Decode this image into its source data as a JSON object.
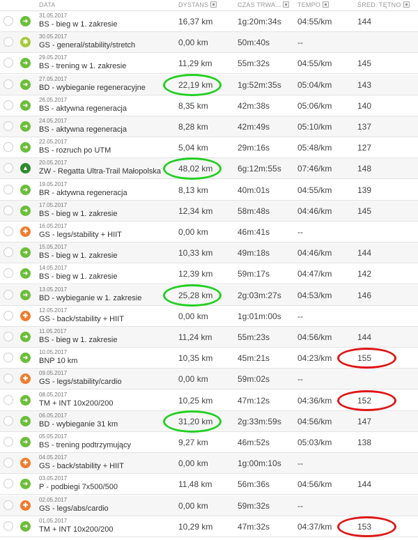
{
  "colors": {
    "sport_green": "#6cbe3a",
    "sport_orange": "#f07c2e",
    "sport_dark_green": "#2e8b2e",
    "sport_yellow_green": "#a6c93a",
    "highlight_green": "#22d022",
    "highlight_red": "#e01515"
  },
  "headers": {
    "date": "DATA",
    "distance": "DYSTANS",
    "duration": "CZAS TRWA...",
    "pace": "TEMPO",
    "heart_rate": "ŚRED. TĘTNO"
  },
  "rows": [
    {
      "date": "31.05.2017",
      "name": "BS - bieg w 1. zakresie",
      "distance": "16,37 km",
      "duration": "1g:20m:34s",
      "pace": "04:55/km",
      "hr": "144",
      "icon": "running-icon",
      "color": "#6cbe3a",
      "glyph": "➜",
      "hl_dist": false,
      "hl_hr": false
    },
    {
      "date": "30.05.2017",
      "name": "GS - general/stability/stretch",
      "distance": "0,00 km",
      "duration": "50m:40s",
      "pace": "--",
      "hr": "",
      "icon": "stretching-icon",
      "color": "#a6c93a",
      "glyph": "✱",
      "hl_dist": false,
      "hl_hr": false
    },
    {
      "date": "29.05.2017",
      "name": "BS - trening w 1. zakresie",
      "distance": "11,29 km",
      "duration": "55m:32s",
      "pace": "04:55/km",
      "hr": "145",
      "icon": "running-icon",
      "color": "#6cbe3a",
      "glyph": "➜",
      "hl_dist": false,
      "hl_hr": false
    },
    {
      "date": "27.05.2017",
      "name": "BD - wybieganie regeneracyjne",
      "distance": "22,19 km",
      "duration": "1g:52m:35s",
      "pace": "05:04/km",
      "hr": "143",
      "icon": "running-icon",
      "color": "#6cbe3a",
      "glyph": "➜",
      "hl_dist": true,
      "hl_hr": false
    },
    {
      "date": "26.05.2017",
      "name": "BS - aktywna regeneracja",
      "distance": "8,35 km",
      "duration": "42m:38s",
      "pace": "05:06/km",
      "hr": "140",
      "icon": "running-icon",
      "color": "#6cbe3a",
      "glyph": "➜",
      "hl_dist": false,
      "hl_hr": false
    },
    {
      "date": "24.05.2017",
      "name": "BS - aktywna regeneracja",
      "distance": "8,28 km",
      "duration": "42m:49s",
      "pace": "05:10/km",
      "hr": "137",
      "icon": "running-icon",
      "color": "#6cbe3a",
      "glyph": "➜",
      "hl_dist": false,
      "hl_hr": false
    },
    {
      "date": "22.05.2017",
      "name": "BS - rozruch po UTM",
      "distance": "5,04 km",
      "duration": "29m:16s",
      "pace": "05:48/km",
      "hr": "127",
      "icon": "running-icon",
      "color": "#6cbe3a",
      "glyph": "➜",
      "hl_dist": false,
      "hl_hr": false
    },
    {
      "date": "20.05.2017",
      "name": "ZW - Regatta Ultra-Trail Małopolska",
      "distance": "48,02 km",
      "duration": "6g:12m:55s",
      "pace": "07:46/km",
      "hr": "148",
      "icon": "trail-running-icon",
      "color": "#2e8b2e",
      "glyph": "▲",
      "hl_dist": true,
      "hl_hr": false
    },
    {
      "date": "19.05.2017",
      "name": "BR - aktywna regeneracja",
      "distance": "8,13 km",
      "duration": "40m:01s",
      "pace": "04:55/km",
      "hr": "139",
      "icon": "running-icon",
      "color": "#6cbe3a",
      "glyph": "➜",
      "hl_dist": false,
      "hl_hr": false
    },
    {
      "date": "17.05.2017",
      "name": "BS - bieg w 1. zakresie",
      "distance": "12,34 km",
      "duration": "58m:48s",
      "pace": "04:46/km",
      "hr": "145",
      "icon": "running-icon",
      "color": "#6cbe3a",
      "glyph": "➜",
      "hl_dist": false,
      "hl_hr": false
    },
    {
      "date": "16.05.2017",
      "name": "GS - legs/stability + HIIT",
      "distance": "0,00 km",
      "duration": "46m:41s",
      "pace": "--",
      "hr": "",
      "icon": "strength-icon",
      "color": "#f07c2e",
      "glyph": "✚",
      "hl_dist": false,
      "hl_hr": false
    },
    {
      "date": "15.05.2017",
      "name": "BS - bieg w 1. zakresie",
      "distance": "10,33 km",
      "duration": "49m:18s",
      "pace": "04:46/km",
      "hr": "144",
      "icon": "running-icon",
      "color": "#6cbe3a",
      "glyph": "➜",
      "hl_dist": false,
      "hl_hr": false
    },
    {
      "date": "14.05.2017",
      "name": "BS - bieg w 1. zakresie",
      "distance": "12,39 km",
      "duration": "59m:17s",
      "pace": "04:47/km",
      "hr": "142",
      "icon": "running-icon",
      "color": "#6cbe3a",
      "glyph": "➜",
      "hl_dist": false,
      "hl_hr": false
    },
    {
      "date": "13.05.2017",
      "name": "BD - wybieganie w 1. zakresie",
      "distance": "25,28 km",
      "duration": "2g:03m:27s",
      "pace": "04:53/km",
      "hr": "146",
      "icon": "running-icon",
      "color": "#6cbe3a",
      "glyph": "➜",
      "hl_dist": true,
      "hl_hr": false
    },
    {
      "date": "12.05.2017",
      "name": "GS - back/stability + HIIT",
      "distance": "0,00 km",
      "duration": "1g:01m:00s",
      "pace": "--",
      "hr": "",
      "icon": "strength-icon",
      "color": "#f07c2e",
      "glyph": "✚",
      "hl_dist": false,
      "hl_hr": false
    },
    {
      "date": "11.05.2017",
      "name": "BS - bieg w 1. zakresie",
      "distance": "11,24 km",
      "duration": "55m:23s",
      "pace": "04:56/km",
      "hr": "144",
      "icon": "running-icon",
      "color": "#6cbe3a",
      "glyph": "➜",
      "hl_dist": false,
      "hl_hr": false
    },
    {
      "date": "10.05.2017",
      "name": "BNP 10 km",
      "distance": "10,35 km",
      "duration": "45m:21s",
      "pace": "04:23/km",
      "hr": "155",
      "icon": "running-icon",
      "color": "#6cbe3a",
      "glyph": "➜",
      "hl_dist": false,
      "hl_hr": true
    },
    {
      "date": "09.05.2017",
      "name": "GS - legs/stability/cardio",
      "distance": "0,00 km",
      "duration": "59m:02s",
      "pace": "--",
      "hr": "",
      "icon": "strength-icon",
      "color": "#f07c2e",
      "glyph": "✚",
      "hl_dist": false,
      "hl_hr": false
    },
    {
      "date": "08.05.2017",
      "name": "TM + INT 10x200/200",
      "distance": "10,25 km",
      "duration": "47m:12s",
      "pace": "04:36/km",
      "hr": "152",
      "icon": "running-icon",
      "color": "#6cbe3a",
      "glyph": "➜",
      "hl_dist": false,
      "hl_hr": true
    },
    {
      "date": "06.05.2017",
      "name": "BD - wybieganie 31 km",
      "distance": "31,20 km",
      "duration": "2g:33m:59s",
      "pace": "04:56/km",
      "hr": "147",
      "icon": "running-icon",
      "color": "#6cbe3a",
      "glyph": "➜",
      "hl_dist": true,
      "hl_hr": false
    },
    {
      "date": "05.05.2017",
      "name": "BS - trening podtrzymujący",
      "distance": "9,27 km",
      "duration": "46m:52s",
      "pace": "05:03/km",
      "hr": "138",
      "icon": "running-icon",
      "color": "#6cbe3a",
      "glyph": "➜",
      "hl_dist": false,
      "hl_hr": false
    },
    {
      "date": "04.05.2017",
      "name": "GS - back/stability + HIIT",
      "distance": "0,00 km",
      "duration": "1g:00m:10s",
      "pace": "--",
      "hr": "",
      "icon": "strength-icon",
      "color": "#f07c2e",
      "glyph": "✚",
      "hl_dist": false,
      "hl_hr": false
    },
    {
      "date": "03.05.2017",
      "name": "P - podbiegi 7x500/500",
      "distance": "11,48 km",
      "duration": "56m:36s",
      "pace": "04:56/km",
      "hr": "144",
      "icon": "running-icon",
      "color": "#6cbe3a",
      "glyph": "➜",
      "hl_dist": false,
      "hl_hr": false
    },
    {
      "date": "02.05.2017",
      "name": "GS - legs/abs/cardio",
      "distance": "0,00 km",
      "duration": "59m:32s",
      "pace": "--",
      "hr": "",
      "icon": "strength-icon",
      "color": "#f07c2e",
      "glyph": "✚",
      "hl_dist": false,
      "hl_hr": false
    },
    {
      "date": "01.05.2017",
      "name": "TM + INT 10x200/200",
      "distance": "10,29 km",
      "duration": "47m:32s",
      "pace": "04:37/km",
      "hr": "153",
      "icon": "running-icon",
      "color": "#6cbe3a",
      "glyph": "➜",
      "hl_dist": false,
      "hl_hr": true
    }
  ]
}
